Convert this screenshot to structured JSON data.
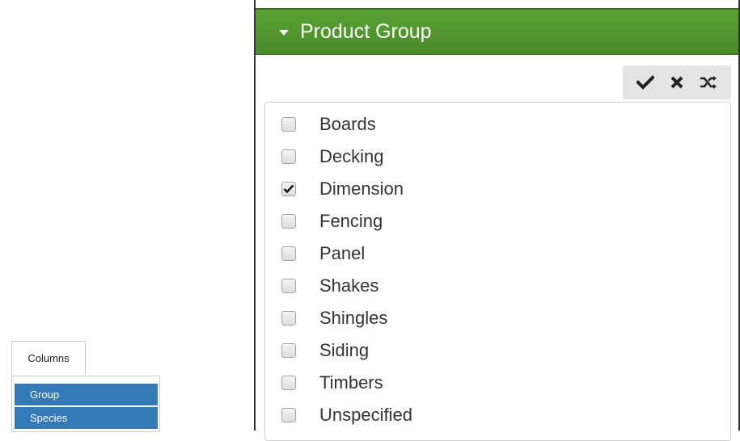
{
  "panel": {
    "title": "Product Group"
  },
  "toolbar": {
    "select_all_icon": "check-icon",
    "clear_icon": "x-icon",
    "invert_icon": "shuffle-icon"
  },
  "options": [
    {
      "label": "Boards",
      "checked": false
    },
    {
      "label": "Decking",
      "checked": false
    },
    {
      "label": "Dimension",
      "checked": true
    },
    {
      "label": "Fencing",
      "checked": false
    },
    {
      "label": "Panel",
      "checked": false
    },
    {
      "label": "Shakes",
      "checked": false
    },
    {
      "label": "Shingles",
      "checked": false
    },
    {
      "label": "Siding",
      "checked": false
    },
    {
      "label": "Timbers",
      "checked": false
    },
    {
      "label": "Unspecified",
      "checked": false
    }
  ],
  "columns_menu": {
    "button_label": "Columns",
    "items": [
      "Group",
      "Species"
    ]
  },
  "colors": {
    "header_green": "#4b8a2a",
    "menu_blue": "#337ab7"
  }
}
